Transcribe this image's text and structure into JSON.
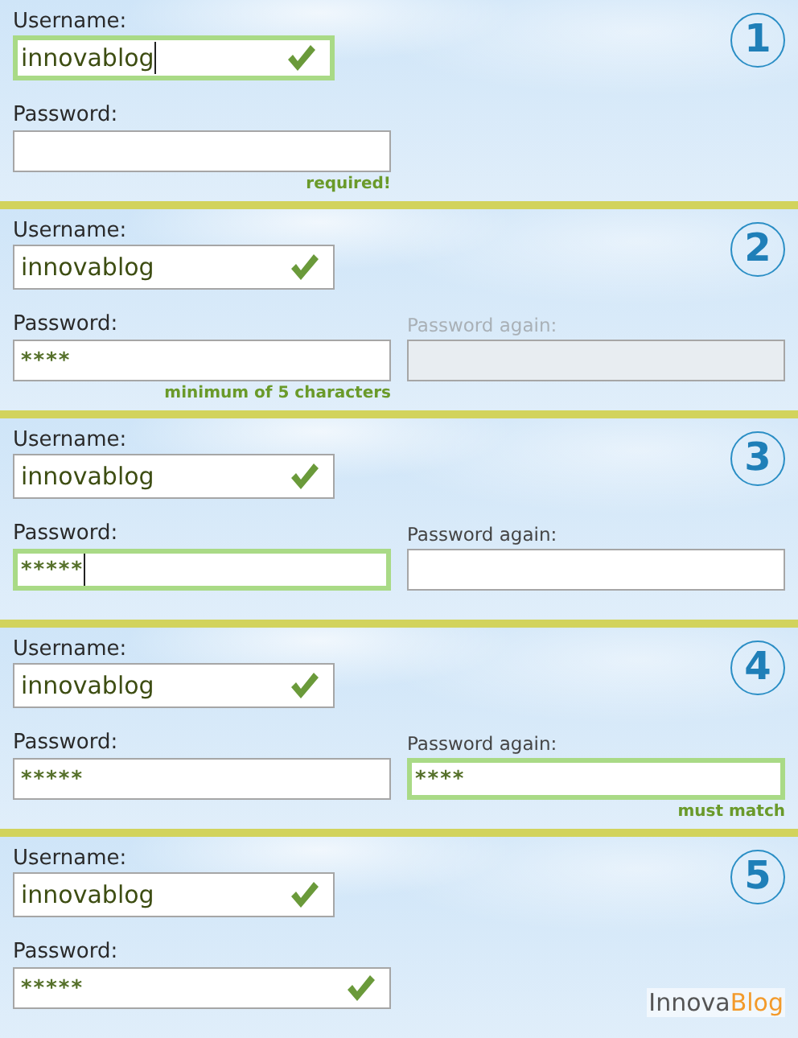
{
  "steps": [
    {
      "number": "1",
      "username": {
        "label": "Username:",
        "value": "innovablog",
        "focused": true,
        "caret": true,
        "valid": true
      },
      "password": {
        "label": "Password:",
        "focused": false,
        "valid": false,
        "hint": "required!"
      }
    },
    {
      "number": "2",
      "username": {
        "label": "Username:",
        "value": "innovablog",
        "focused": false,
        "valid": true
      },
      "password": {
        "label": "Password:",
        "value": "****",
        "focused": false,
        "valid": false,
        "hint": "minimum of 5 characters"
      },
      "password_again": {
        "label": "Password again:",
        "disabled": true,
        "focused": false
      }
    },
    {
      "number": "3",
      "username": {
        "label": "Username:",
        "value": "innovablog",
        "focused": false,
        "valid": true
      },
      "password": {
        "label": "Password:",
        "value": "*****",
        "focused": true,
        "caret": true,
        "valid": false
      },
      "password_again": {
        "label": "Password again:",
        "disabled": false,
        "focused": false
      }
    },
    {
      "number": "4",
      "username": {
        "label": "Username:",
        "value": "innovablog",
        "focused": false,
        "valid": true
      },
      "password": {
        "label": "Password:",
        "value": "*****",
        "focused": false,
        "valid": false
      },
      "password_again": {
        "label": "Password again:",
        "value": "****",
        "disabled": false,
        "focused": true,
        "hint": "must match"
      }
    },
    {
      "number": "5",
      "username": {
        "label": "Username:",
        "value": "innovablog",
        "focused": false,
        "valid": true
      },
      "password": {
        "label": "Password:",
        "value": "*****",
        "focused": false,
        "valid": true
      },
      "logo": {
        "parts": [
          "Innova",
          "Blog"
        ]
      }
    }
  ]
}
